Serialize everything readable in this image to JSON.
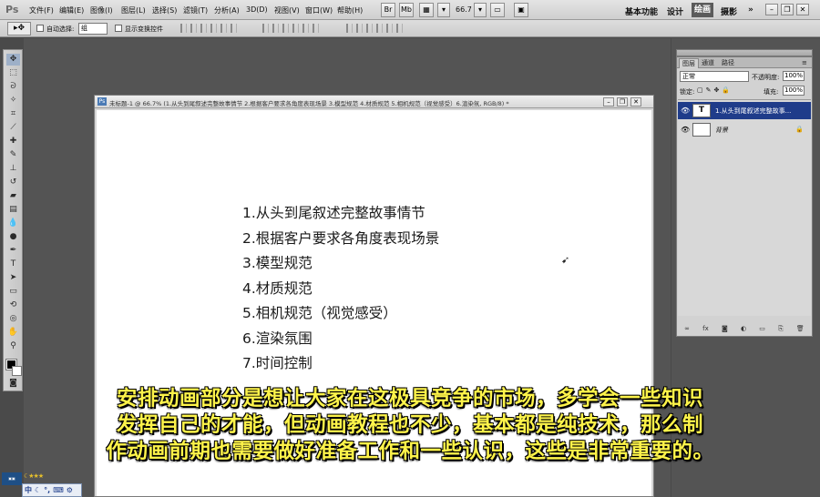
{
  "app": {
    "logo": "Ps"
  },
  "menubar": {
    "items": [
      "文件(F)",
      "编辑(E)",
      "图像(I)",
      "图层(L)",
      "选择(S)",
      "滤镜(T)",
      "分析(A)",
      "3D(D)",
      "视图(V)",
      "窗口(W)",
      "帮助(H)"
    ],
    "btn_br": "Br",
    "btn_mb": "Mb",
    "zoom": "66.7",
    "workspaces": [
      "基本功能",
      "设计"
    ],
    "active_workspace": "绘画",
    "workspace_after": "摄影"
  },
  "options_bar": {
    "auto_select_label": "自动选择:",
    "auto_select_value": "组",
    "show_transform_label": "显示变换控件"
  },
  "document": {
    "title": "未标题-1 @ 66.7% (1.从头到尾叙述完整故事情节 2.根据客户要求各角度表现场景 3.模型规范 4.材质规范 5.相机规范（视觉感受）6.渲染氛, RGB/8) *",
    "lines": [
      "1.从头到尾叙述完整故事情节",
      "2.根据客户要求各角度表现场景",
      "3.模型规范",
      "4.材质规范",
      "5.相机规范（视觉感受）",
      "6.渲染氛围",
      "7.时间控制"
    ]
  },
  "layers_panel": {
    "tabs": [
      "图层",
      "通道",
      "路径"
    ],
    "blend_mode": "正常",
    "opacity_label": "不透明度:",
    "opacity_value": "100%",
    "lock_label": "锁定:",
    "fill_label": "填充:",
    "fill_value": "100%",
    "layers": [
      {
        "name": "1.从头到尾叙述完整故事...",
        "thumb": "T",
        "selected": true
      },
      {
        "name": "背景",
        "thumb": "",
        "selected": false
      }
    ]
  },
  "subtitles": [
    "安排动画部分是想让大家在这极具竞争的市场，多学会一些知识",
    "发挥自己的才能，但动画教程也不少，基本都是纯技术，那么制",
    "作动画前期也需要做好准备工作和一些认识，这些是非常重要的。"
  ],
  "ime": {
    "mode": "中"
  }
}
